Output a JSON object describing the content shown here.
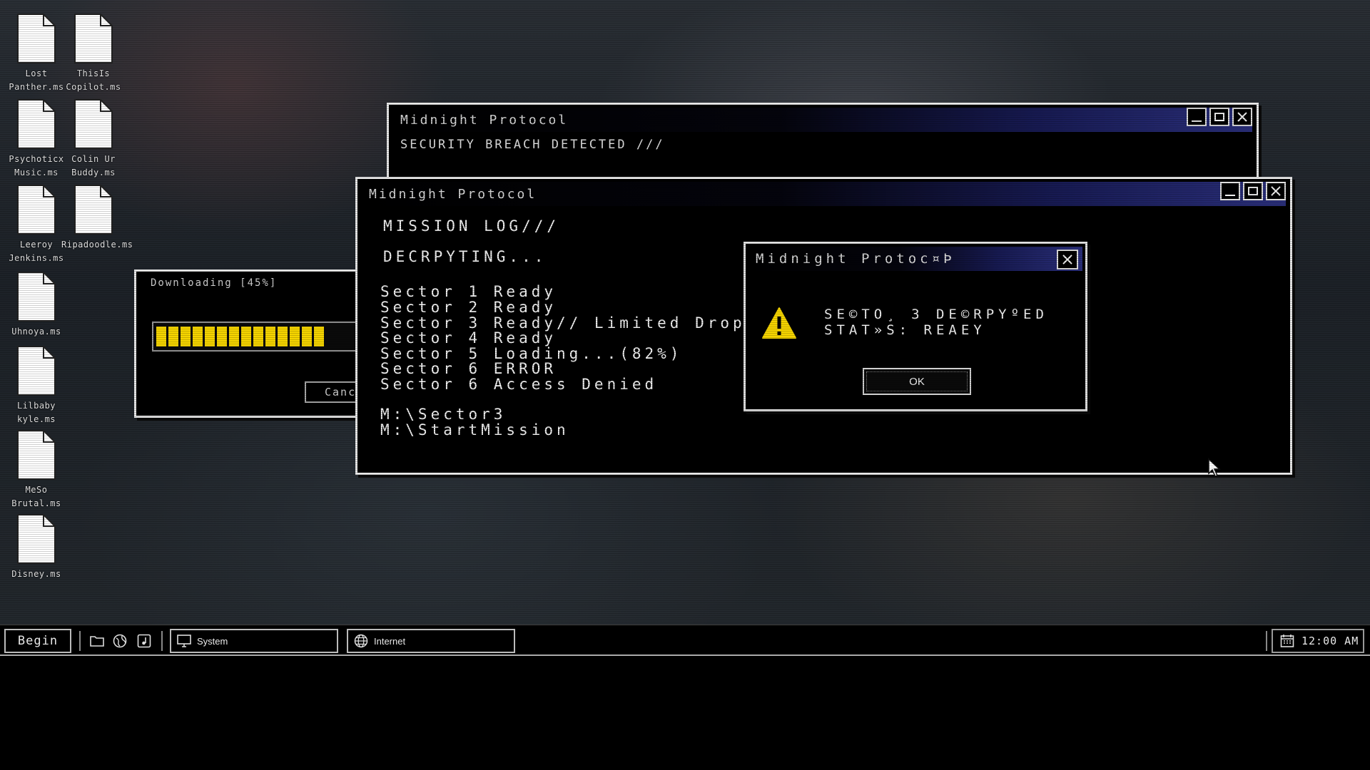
{
  "desktop_icons": [
    {
      "label": "Lost\nPanther.ms"
    },
    {
      "label": "ThisIs\nCopilot.ms"
    },
    {
      "label": "Psychoticx\nMusic.ms"
    },
    {
      "label": "Colin Ur\nBuddy.ms"
    },
    {
      "label": "Leeroy\nJenkins.ms"
    },
    {
      "label": "Ripadoodle.ms"
    },
    {
      "label": "Uhnoya.ms"
    },
    {
      "label": "Lilbaby\nkyle.ms"
    },
    {
      "label": "MeSo\nBrutal.ms"
    },
    {
      "label": "Disney.ms"
    }
  ],
  "window_back": {
    "title": "Midnight Protocol",
    "body": "SECURITY BREACH DETECTED ///"
  },
  "window_download": {
    "title": "Downloading [45%]",
    "progress_fraction": 0.45,
    "progress_color": "#f5d400",
    "cancel_label": "Cance"
  },
  "window_main": {
    "title": "Midnight Protocol",
    "lines": [
      "MISSION LOG///",
      "DECRPYTING...",
      "Sector 1 Ready",
      "Sector 2 Ready",
      "Sector 3 Ready// Limited Drop-ins",
      "Sector 4 Ready",
      "Sector 5 Loading...(82%)",
      "Sector 6 ERROR",
      "Sector 6 Access Denied",
      "M:\\Sector3",
      "M:\\StartMission"
    ]
  },
  "dialog": {
    "title": "Midnight Protoc¤Þ",
    "message_line1": "SE©TO¸ 3 DE©RPYºED",
    "message_line2": "STAT»S: REAEY",
    "ok_label": "OK",
    "icon": "warning-icon",
    "warning_color": "#f5d400"
  },
  "taskbar": {
    "start_label": "Begin",
    "quick_launch": [
      "folder-icon",
      "globe-icon",
      "music-icon"
    ],
    "tasks": [
      {
        "label": "System",
        "icon": "monitor-icon"
      },
      {
        "label": "Internet",
        "icon": "globe-icon"
      }
    ],
    "clock": "12:00 AM",
    "clock_icon": "calendar-icon"
  }
}
